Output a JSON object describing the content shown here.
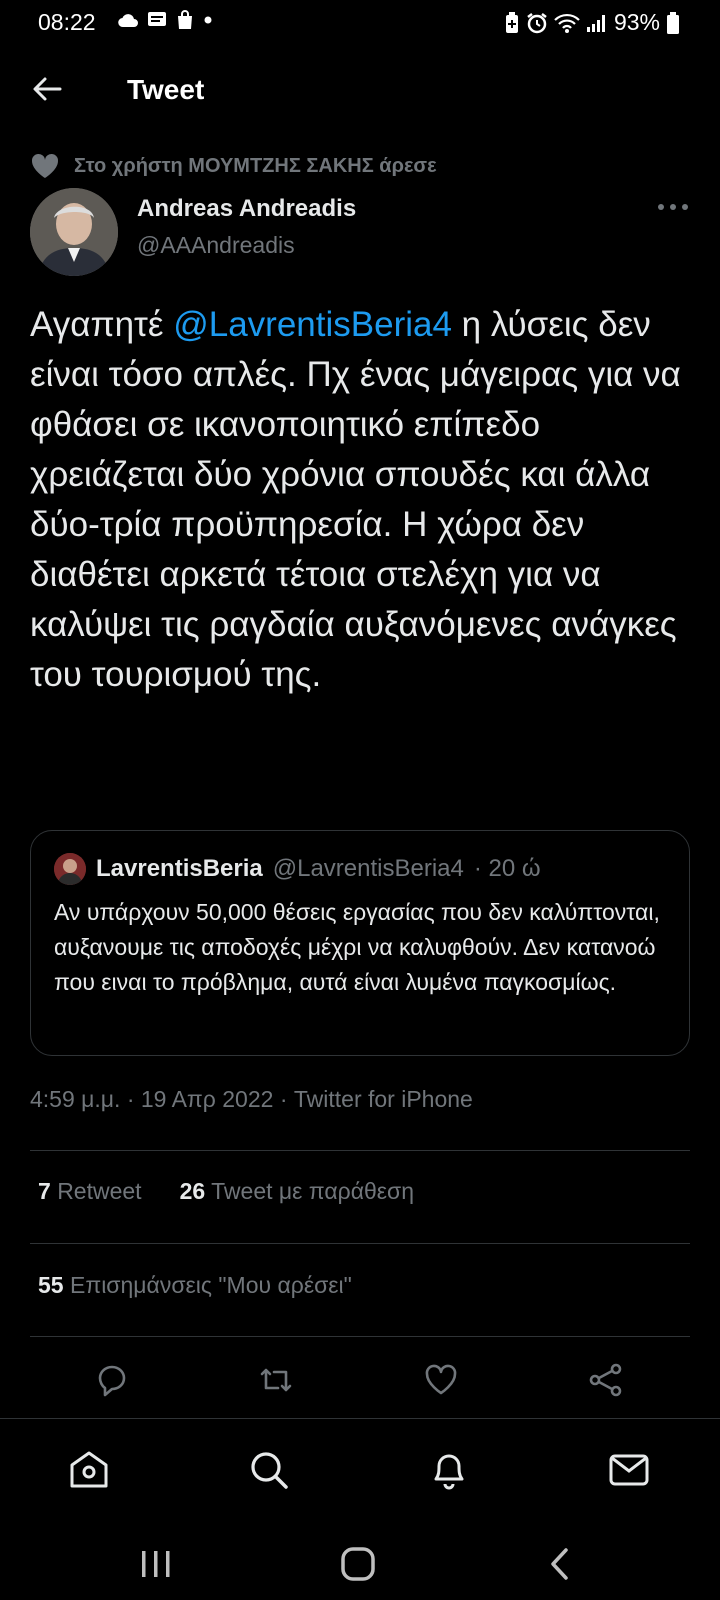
{
  "status_bar": {
    "time": "08:22",
    "battery": "93%",
    "left_icons": [
      "cloud-icon",
      "message-icon",
      "shopping-bag-icon",
      "dot-icon"
    ],
    "right_icons": [
      "battery-saver-icon",
      "alarm-icon",
      "wifi-icon",
      "signal-icon",
      "battery-icon"
    ]
  },
  "header": {
    "title": "Tweet"
  },
  "social_context": {
    "text": "Στο χρήστη ΜΟΥΜΤΖΗΣ ΣΑΚΗΣ άρεσε"
  },
  "author": {
    "name": "Andreas Andreadis",
    "handle": "@AAAndreadis"
  },
  "tweet": {
    "prefix": "Αγαπητέ ",
    "mention": "@LavrentisBeria4",
    "body": " η λύσεις δεν είναι τόσο απλές. Πχ ένας μάγειρας για να φθάσει σε ικανοποιητικό επίπεδο χρειάζεται δύο χρόνια σπουδές και άλλα δύο-τρία προϋπηρεσία. Η χώρα δεν διαθέτει αρκετά τέτοια στελέχη για να καλύψει τις ραγδαία αυξανόμενες ανάγκες του τουρισμού της."
  },
  "quoted": {
    "name": "LavrentisBeria",
    "handle": "@LavrentisBeria4",
    "time": "· 20 ώ",
    "text": "Αν υπάρχουν 50,000 θέσεις εργασίας που δεν καλύπτονται, αυξανουμε τις αποδοχές μέχρι να καλυφθούν. Δεν κατανοώ που ειναι το πρόβλημα, αυτά είναι λυμένα παγκοσμίως."
  },
  "meta": {
    "text": "4:59 μ.μ. · 19 Απρ 2022 · Twitter for iPhone"
  },
  "stats": {
    "retweets_count": "7",
    "retweets_label": "Retweet",
    "quotes_count": "26",
    "quotes_label": "Tweet με παράθεση",
    "likes_count": "55",
    "likes_label": "Επισημάνσεις \"Μου αρέσει\""
  },
  "actions": [
    "reply-icon",
    "retweet-icon",
    "like-icon",
    "share-icon"
  ],
  "bottom_nav": [
    "home-icon",
    "search-icon",
    "notifications-icon",
    "messages-icon"
  ],
  "system_nav": [
    "recents-icon",
    "home-button-icon",
    "back-icon"
  ],
  "colors": {
    "background": "#000000",
    "text": "#e7e9ea",
    "secondary": "#71767b",
    "accent": "#1d9bf0",
    "divider": "#2f3336"
  }
}
